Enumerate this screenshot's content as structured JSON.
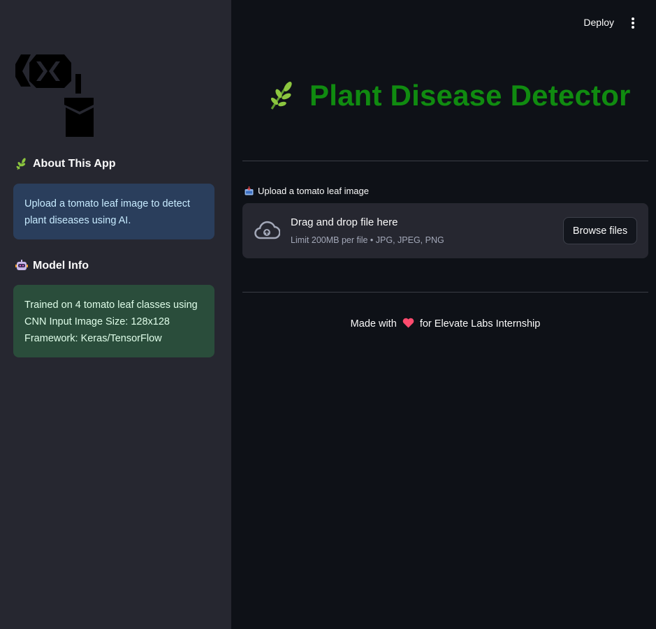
{
  "sidebar": {
    "about_heading": "About This App",
    "about_text": "Upload a tomato leaf image to detect plant diseases using AI.",
    "model_heading": "Model Info",
    "model_text_line1": "Trained on 4 tomato leaf classes using",
    "model_text_line2": "CNN Input Image Size: 128x128",
    "model_text_line3": "Framework: Keras/TensorFlow"
  },
  "header": {
    "deploy_label": "Deploy",
    "menu_icon": "kebab-menu-icon"
  },
  "main": {
    "title": "Plant Disease Detector",
    "title_color": "#108b10",
    "upload_label": "Upload a tomato leaf image",
    "dropzone_title": "Drag and drop file here",
    "dropzone_limit": "Limit 200MB per file • JPG, JPEG, PNG",
    "browse_label": "Browse files",
    "footer_before": "Made with",
    "footer_after": "for Elevate Labs Internship"
  },
  "icons": {
    "leaf": "herb-leaf-icon",
    "robot": "robot-icon",
    "inbox": "inbox-tray-icon",
    "cloud": "cloud-upload-icon",
    "heart": "heart-icon"
  },
  "colors": {
    "sidebar_bg": "#262730",
    "main_bg": "#0e1117",
    "info_blue": "#2a3e5c",
    "info_green": "#2a4d3b"
  }
}
